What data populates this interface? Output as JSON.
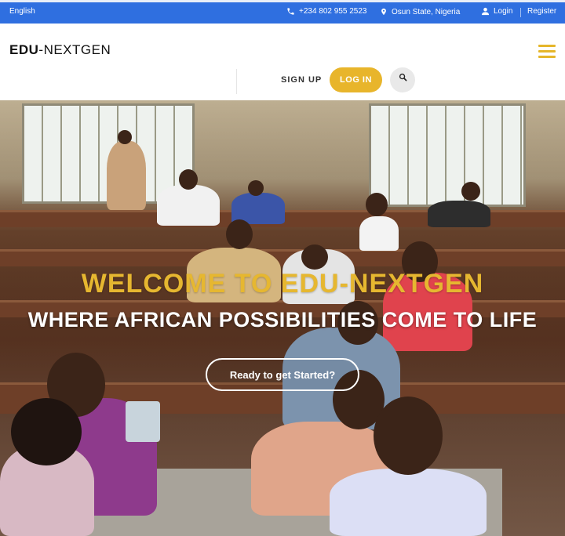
{
  "topbar": {
    "language": "English",
    "phone": "+234 802 955 2523",
    "location": "Osun State, Nigeria",
    "login": "Login",
    "register": "Register"
  },
  "header": {
    "logo_bold": "EDU",
    "logo_rest": "-NEXTGEN",
    "signup": "SIGN UP",
    "login_button": "LOG IN"
  },
  "hero": {
    "title": "WELCOME TO EDU-NEXTGEN",
    "subtitle": "WHERE AFRICAN POSSIBILITIES COME TO LIFE",
    "cta": "Ready to get Started?"
  },
  "colors": {
    "topbar": "#2f6fe0",
    "accent": "#e8b52b",
    "hamburger": "#e5b62a"
  },
  "icons": [
    "phone-icon",
    "location-pin-icon",
    "user-icon",
    "search-icon",
    "hamburger-menu-icon"
  ]
}
